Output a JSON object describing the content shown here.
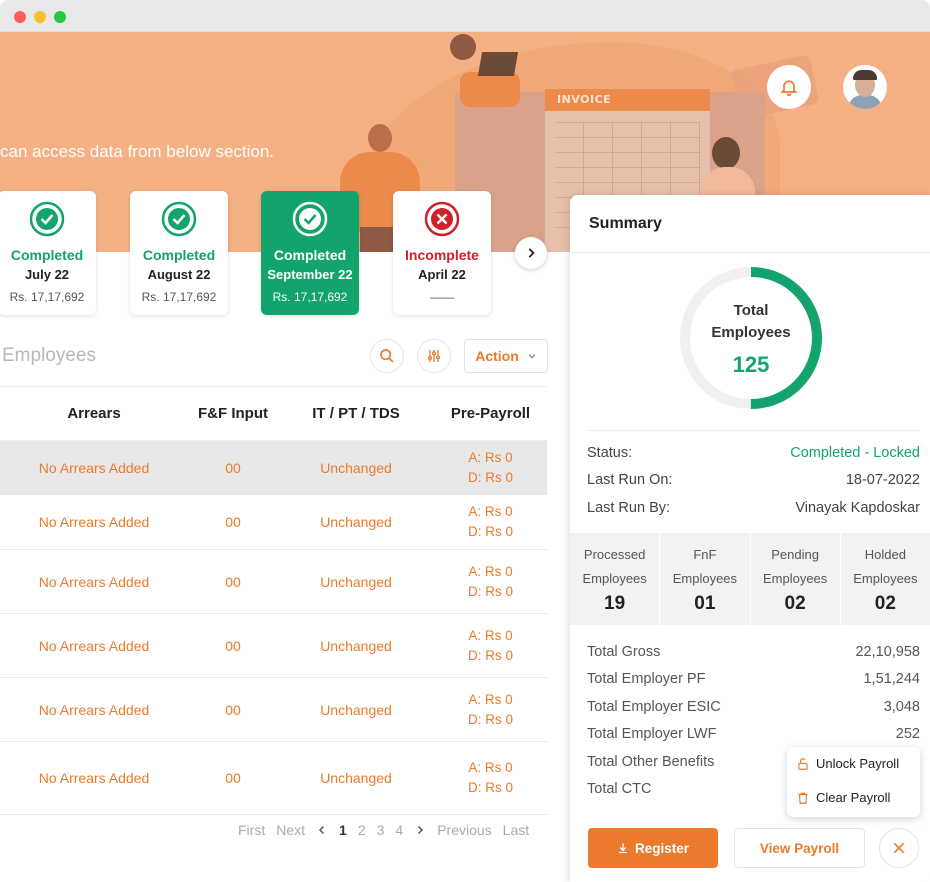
{
  "banner": {
    "text": "can access data from below section.",
    "invoice_label": "INVOICE"
  },
  "header": {
    "bell_icon": "bell-icon",
    "avatar": "user-avatar"
  },
  "months": [
    {
      "status": "Completed",
      "month": "July 22",
      "amount": "Rs. 17,17,692"
    },
    {
      "status": "Completed",
      "month": "August 22",
      "amount": "Rs. 17,17,692"
    },
    {
      "status": "Completed",
      "month": "September 22",
      "amount": "Rs. 17,17,692"
    },
    {
      "status": "Incomplete",
      "month": "April 22",
      "amount": "——"
    }
  ],
  "employees": {
    "title": "Employees",
    "action_label": "Action",
    "columns": [
      "Arrears",
      "F&F Input",
      "IT / PT / TDS",
      "Pre-Payroll"
    ],
    "rows": [
      {
        "arrears": "No Arrears Added",
        "ff": "00",
        "it": "Unchanged",
        "pre_a": "A: Rs 0",
        "pre_d": "D: Rs 0"
      },
      {
        "arrears": "No Arrears Added",
        "ff": "00",
        "it": "Unchanged",
        "pre_a": "A: Rs 0",
        "pre_d": "D: Rs 0"
      },
      {
        "arrears": "No Arrears Added",
        "ff": "00",
        "it": "Unchanged",
        "pre_a": "A: Rs 0",
        "pre_d": "D: Rs 0"
      },
      {
        "arrears": "No Arrears Added",
        "ff": "00",
        "it": "Unchanged",
        "pre_a": "A: Rs 0",
        "pre_d": "D: Rs 0"
      },
      {
        "arrears": "No Arrears Added",
        "ff": "00",
        "it": "Unchanged",
        "pre_a": "A: Rs 0",
        "pre_d": "D: Rs 0"
      },
      {
        "arrears": "No Arrears Added",
        "ff": "00",
        "it": "Unchanged",
        "pre_a": "A: Rs 0",
        "pre_d": "D: Rs 0"
      }
    ]
  },
  "pager": {
    "first": "First",
    "next": "Next",
    "pages": [
      "1",
      "2",
      "3",
      "4"
    ],
    "previous": "Previous",
    "last": "Last"
  },
  "summary": {
    "title": "Summary",
    "donut_label_1": "Total",
    "donut_label_2": "Employees",
    "total_employees": "125",
    "donut_fraction": 0.5,
    "status_label": "Status:",
    "status_value": "Completed - Locked",
    "last_run_on_label": "Last Run On:",
    "last_run_on_value": "18-07-2022",
    "last_run_by_label": "Last Run By:",
    "last_run_by_value": "Vinayak Kapdoskar",
    "stats": [
      {
        "l1": "Processed",
        "l2": "Employees",
        "value": "19"
      },
      {
        "l1": "FnF",
        "l2": "Employees",
        "value": "01"
      },
      {
        "l1": "Pending",
        "l2": "Employees",
        "value": "02"
      },
      {
        "l1": "Holded",
        "l2": "Employees",
        "value": "02"
      }
    ],
    "totals": [
      {
        "label": "Total Gross",
        "value": "22,10,958"
      },
      {
        "label": "Total Employer PF",
        "value": "1,51,244"
      },
      {
        "label": "Total Employer ESIC",
        "value": "3,048"
      },
      {
        "label": "Total Employer LWF",
        "value": "252"
      },
      {
        "label": "Total Other Benefits",
        "value": ""
      },
      {
        "label": "Total CTC",
        "value": ""
      }
    ],
    "popup": {
      "unlock": "Unlock Payroll",
      "clear": "Clear Payroll"
    },
    "register_label": "Register",
    "view_payroll_label": "View Payroll"
  },
  "colors": {
    "accent": "#ec7a2c",
    "success": "#12a46c",
    "danger": "#d0202a",
    "banner": "#f5b083"
  }
}
